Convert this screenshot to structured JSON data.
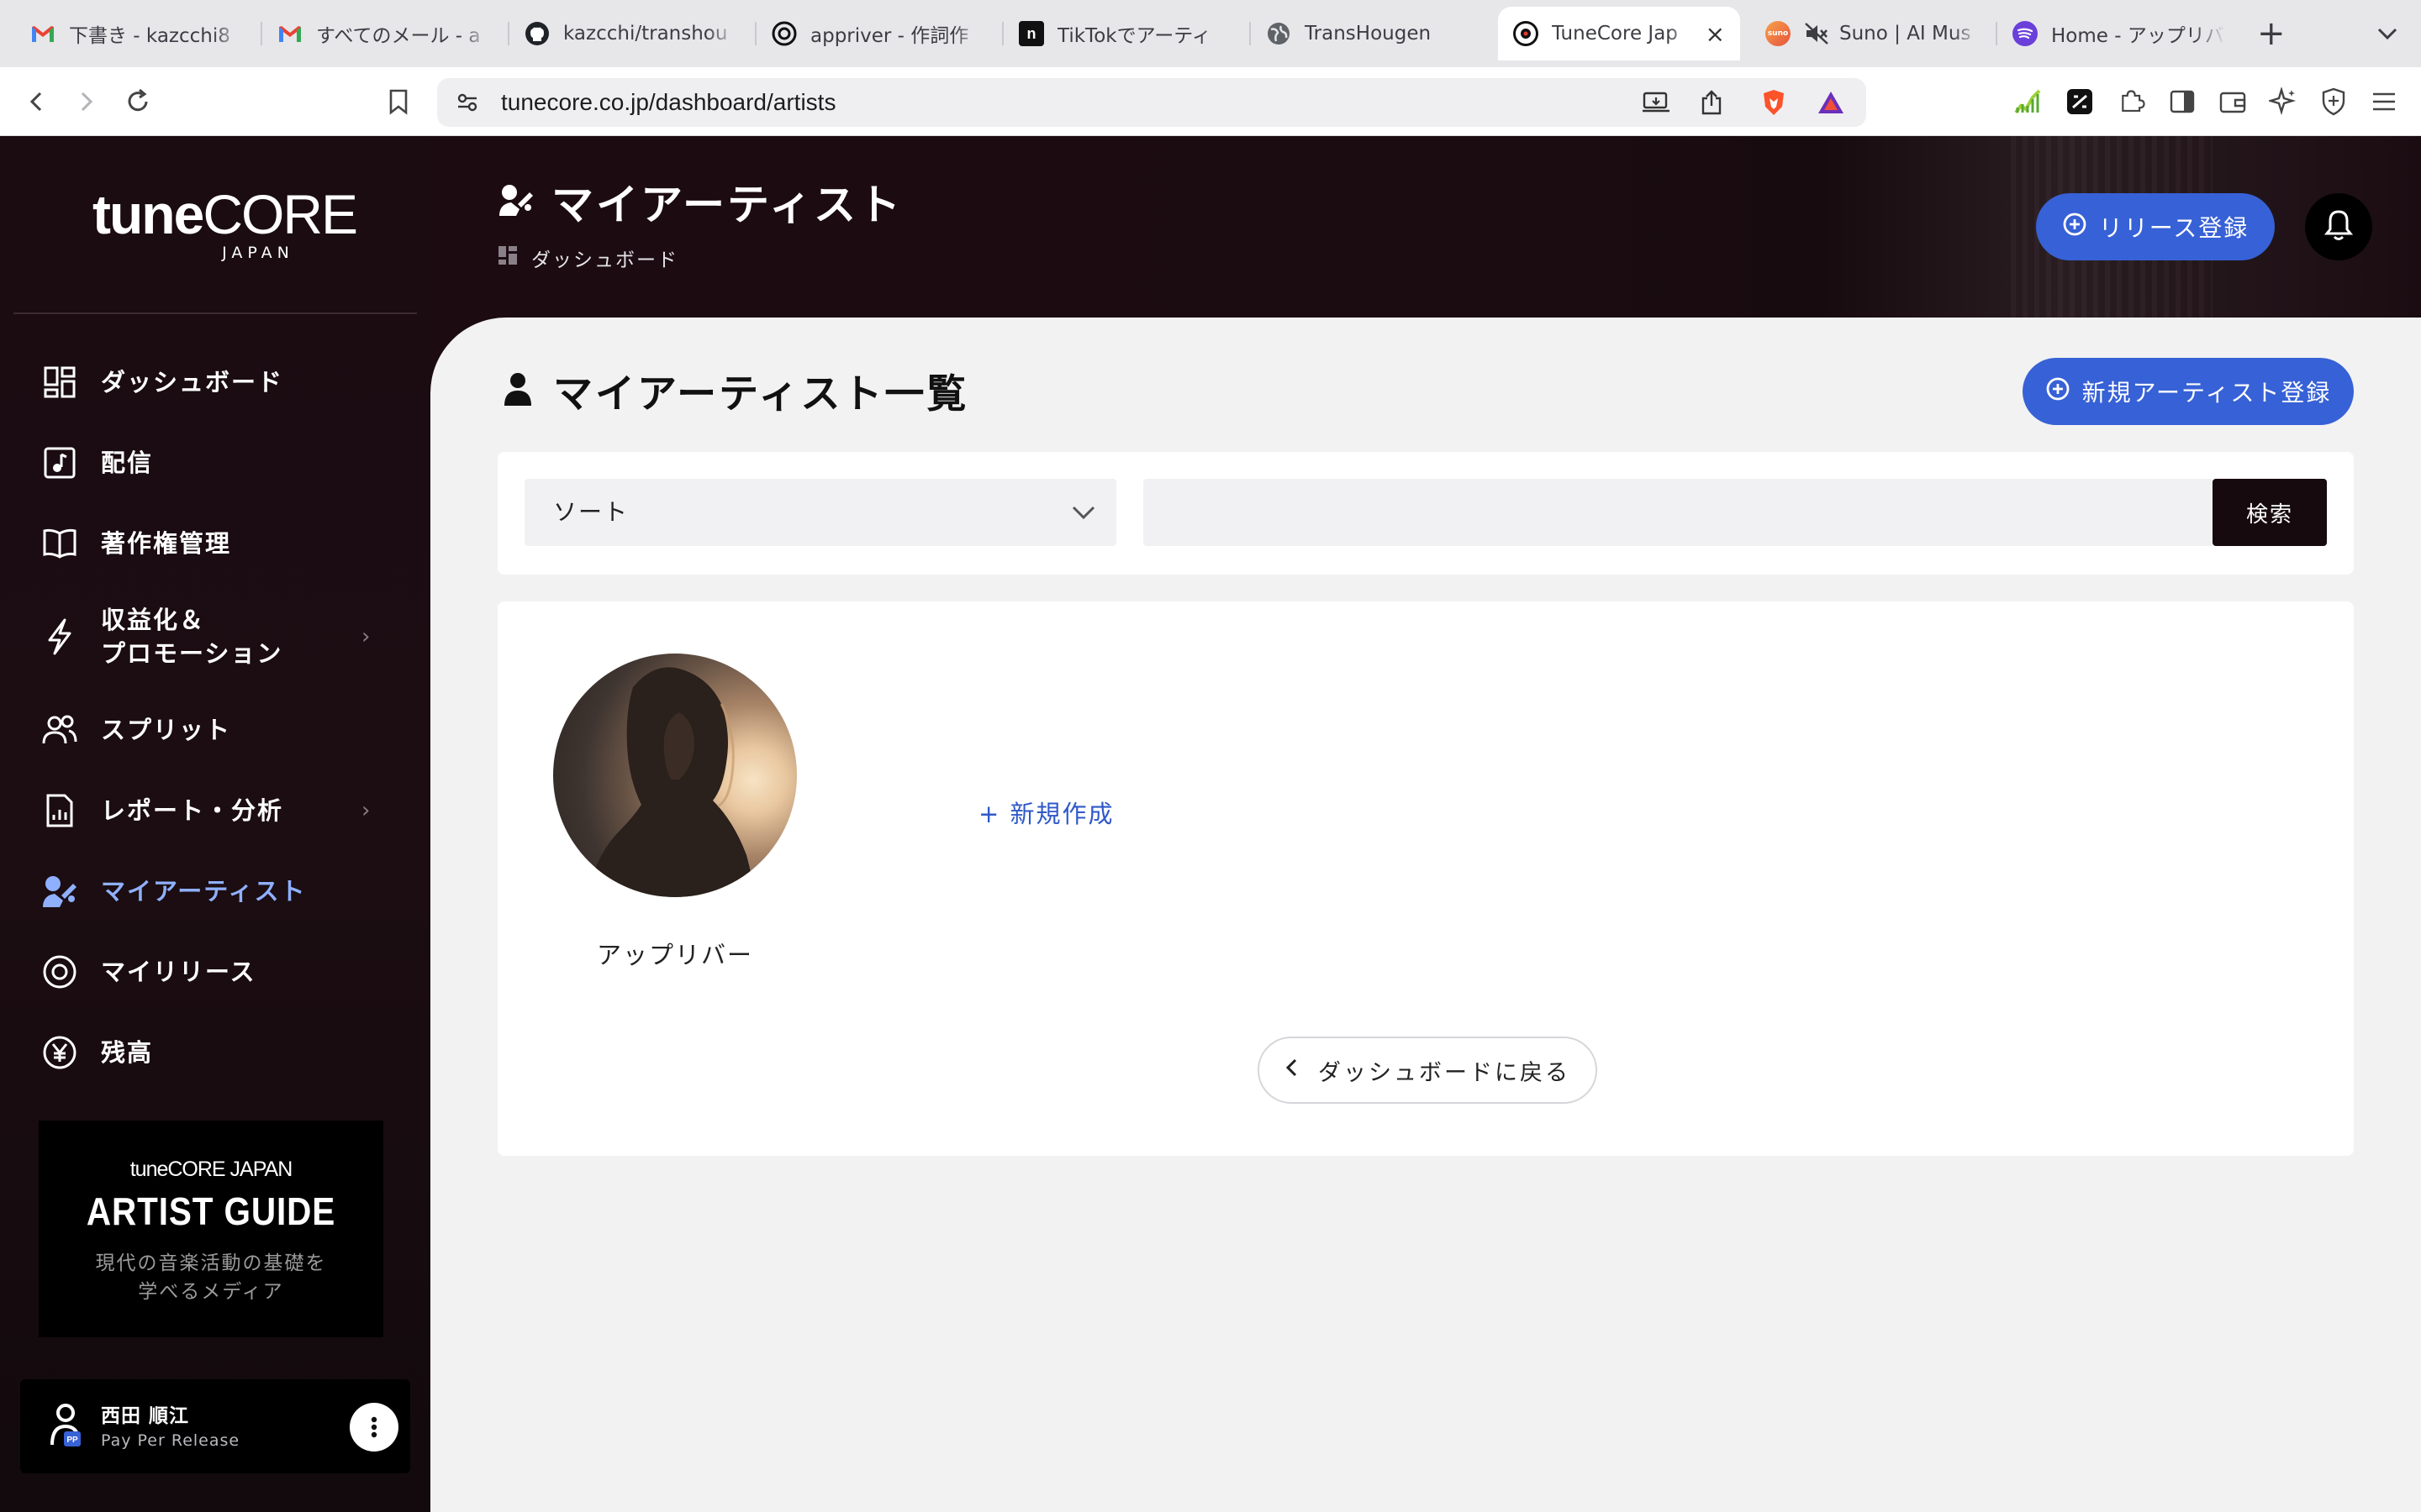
{
  "browser": {
    "tabs": [
      {
        "label": "下書き - kazcchi8",
        "icon": "gmail-icon",
        "active": false
      },
      {
        "label": "すべてのメール - a",
        "icon": "gmail-icon",
        "active": false
      },
      {
        "label": "kazcchi/transhou",
        "icon": "github-icon",
        "active": false
      },
      {
        "label": "appriver - 作詞作",
        "icon": "chatgpt-icon",
        "active": false
      },
      {
        "label": "TikTokでアーティ",
        "icon": "notion-icon",
        "active": false
      },
      {
        "label": "TransHougen",
        "icon": "globe-icon",
        "active": false
      },
      {
        "label": "TuneCore Jap",
        "icon": "tunecore-icon",
        "active": true
      },
      {
        "label": "Suno | AI Mus",
        "icon": "suno-icon",
        "active": false
      },
      {
        "label": "Home - アップリバ",
        "icon": "spotify-icon",
        "active": false
      }
    ],
    "url": "tunecore.co.jp/dashboard/artists"
  },
  "brand": {
    "main_bold": "tune",
    "main_light": "CORE",
    "sub": "JAPAN"
  },
  "sidebar": {
    "items": [
      {
        "label": "ダッシュボード",
        "icon": "dashboard-icon"
      },
      {
        "label": "配信",
        "icon": "music-note-icon"
      },
      {
        "label": "著作権管理",
        "icon": "book-icon"
      },
      {
        "label": "収益化＆\nプロモーション",
        "icon": "lightning-icon"
      },
      {
        "label": "スプリット",
        "icon": "users-icon"
      },
      {
        "label": "レポート・分析",
        "icon": "report-icon"
      },
      {
        "label": "マイアーティスト",
        "icon": "artist-icon"
      },
      {
        "label": "マイリリース",
        "icon": "disc-icon"
      },
      {
        "label": "残高",
        "icon": "yen-icon"
      }
    ],
    "active_item": "マイアーティスト",
    "guide": {
      "brand": "tuneCORE JAPAN",
      "title": "ARTIST GUIDE",
      "desc_line1": "現代の音楽活動の基礎を",
      "desc_line2": "学べるメディア"
    },
    "user": {
      "name": "西田 順江",
      "plan": "Pay Per Release",
      "badge": "PP"
    }
  },
  "header": {
    "title": "マイアーティスト",
    "breadcrumb": "ダッシュボード",
    "release_button": "リリース登録"
  },
  "main": {
    "section_title": "マイアーティスト一覧",
    "new_artist_button": "新規アーティスト登録",
    "sort_label": "ソート",
    "search_placeholder": "",
    "search_button": "検索",
    "artists": [
      {
        "name": "アップリバー"
      }
    ],
    "new_link": "+ 新規作成",
    "back_button": "ダッシュボードに戻る"
  },
  "colors": {
    "accent_blue": "#3761d6",
    "sidebar_bg": "#1a0c11",
    "active_nav": "#8fb0ff",
    "link_blue": "#2f59c9"
  }
}
